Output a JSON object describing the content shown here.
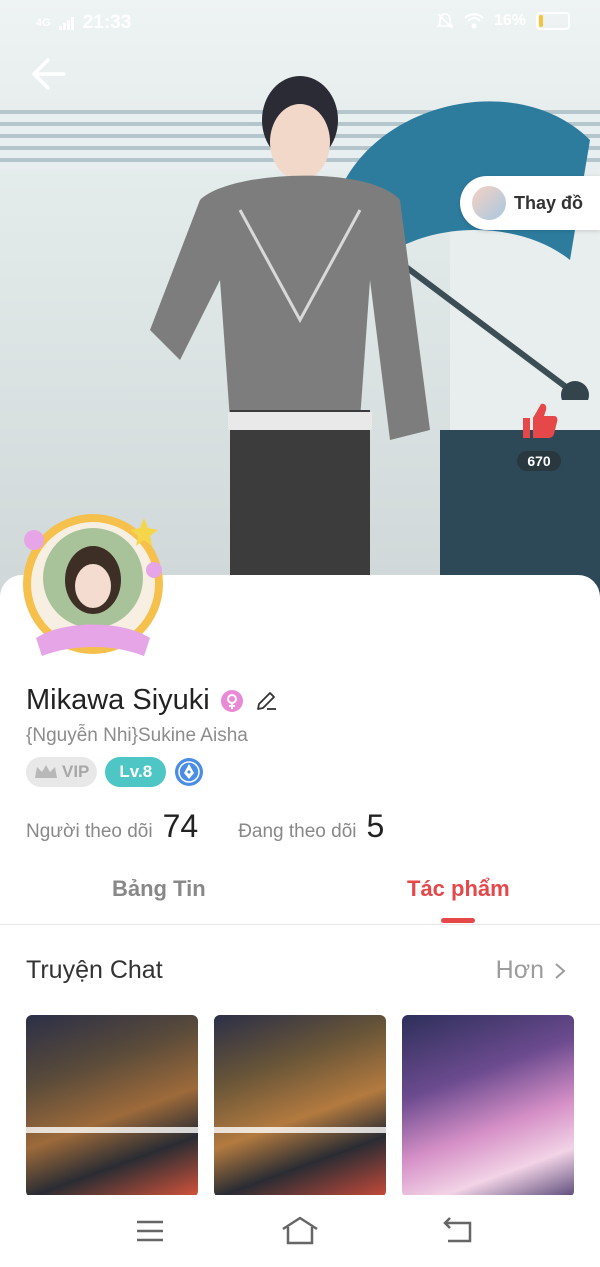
{
  "status_bar": {
    "network": "4G",
    "time": "21:33",
    "battery_percent": "16%",
    "battery_level": 0.16,
    "icons": [
      "signal-icon",
      "mute-icon",
      "wifi-icon",
      "battery-icon"
    ]
  },
  "header": {
    "back_icon": "arrow-left-icon",
    "change_outfit_label": "Thay đồ",
    "like_count": "670",
    "like_icon": "thumbs-up-icon"
  },
  "profile": {
    "name": "Mikawa Siyuki",
    "gender_icon": "female-icon",
    "edit_icon": "pencil-icon",
    "subtitle": "{Nguyễn Nhi}Sukine Aisha",
    "vip_label": "VIP",
    "level_label": "Lv.8",
    "badge_icon": "pen-nib-badge-icon"
  },
  "stats": {
    "followers_label": "Người theo dõi",
    "followers_count": "74",
    "following_label": "Đang theo dõi",
    "following_count": "5"
  },
  "tabs": [
    {
      "label": "Bảng Tin",
      "active": false
    },
    {
      "label": "Tác phẩm",
      "active": true
    }
  ],
  "section": {
    "title": "Truyện Chat",
    "more_label": "Hơn"
  },
  "colors": {
    "accent": "#e6484a",
    "level_badge": "#4fc6c6",
    "vip_badge": "#e8e8e8"
  },
  "navbar": {
    "icons": [
      "menu-icon",
      "home-icon",
      "back-nav-icon"
    ]
  }
}
